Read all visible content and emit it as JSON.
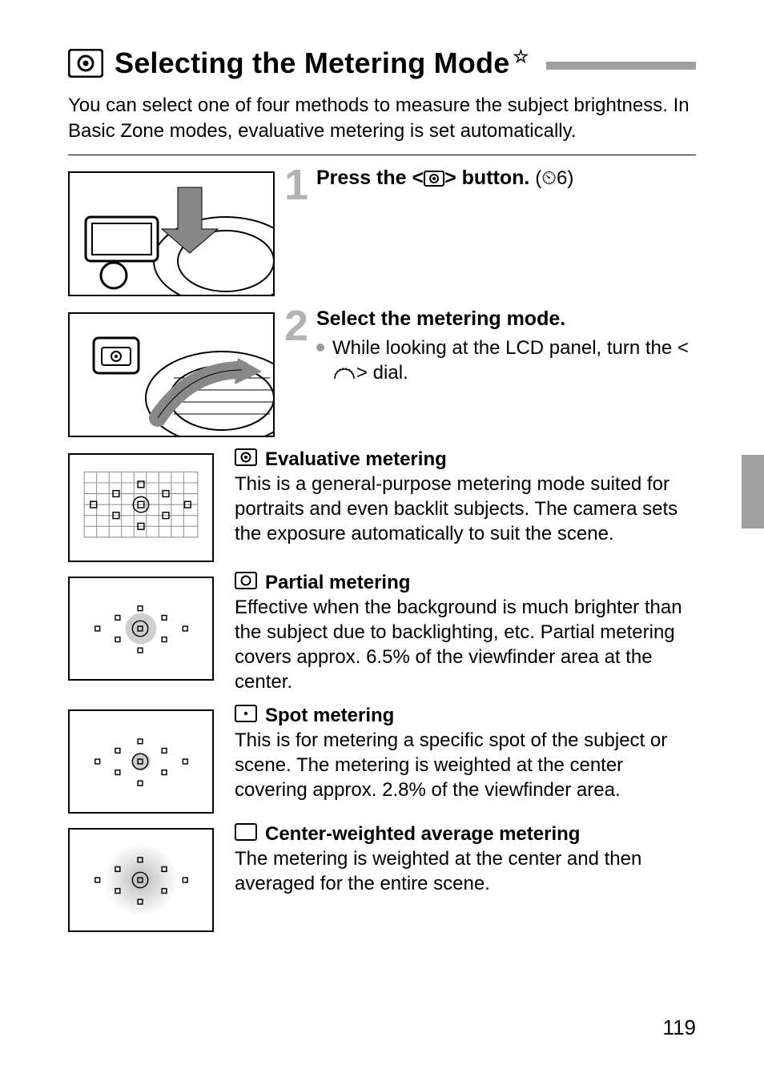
{
  "title": "Selecting the Metering Mode",
  "title_star": "☆",
  "intro": "You can select one of four methods to measure the subject brightness. In Basic Zone modes, evaluative metering is set automatically.",
  "steps": [
    {
      "num": "1",
      "heading_prefix": "Press the <",
      "heading_suffix": "> button.",
      "note": " (⏲6)"
    },
    {
      "num": "2",
      "heading": "Select the metering mode.",
      "bullet_prefix": "While looking at the LCD panel, turn the <",
      "bullet_suffix": "> dial."
    }
  ],
  "modes": [
    {
      "name": "Evaluative metering",
      "body": "This is a general-purpose metering mode suited for portraits and even backlit subjects. The camera sets the exposure automatically to suit the scene."
    },
    {
      "name": "Partial metering",
      "body": "Effective when the background is much brighter than the subject due to backlighting, etc. Partial metering covers approx. 6.5% of the viewfinder area at the center."
    },
    {
      "name": "Spot metering",
      "body": "This is for metering a specific spot of the subject or scene. The metering is weighted at the center covering approx. 2.8% of the viewfinder area."
    },
    {
      "name": "Center-weighted average metering",
      "body": "The metering is weighted at the center and then averaged for the entire scene."
    }
  ],
  "page_number": "119"
}
